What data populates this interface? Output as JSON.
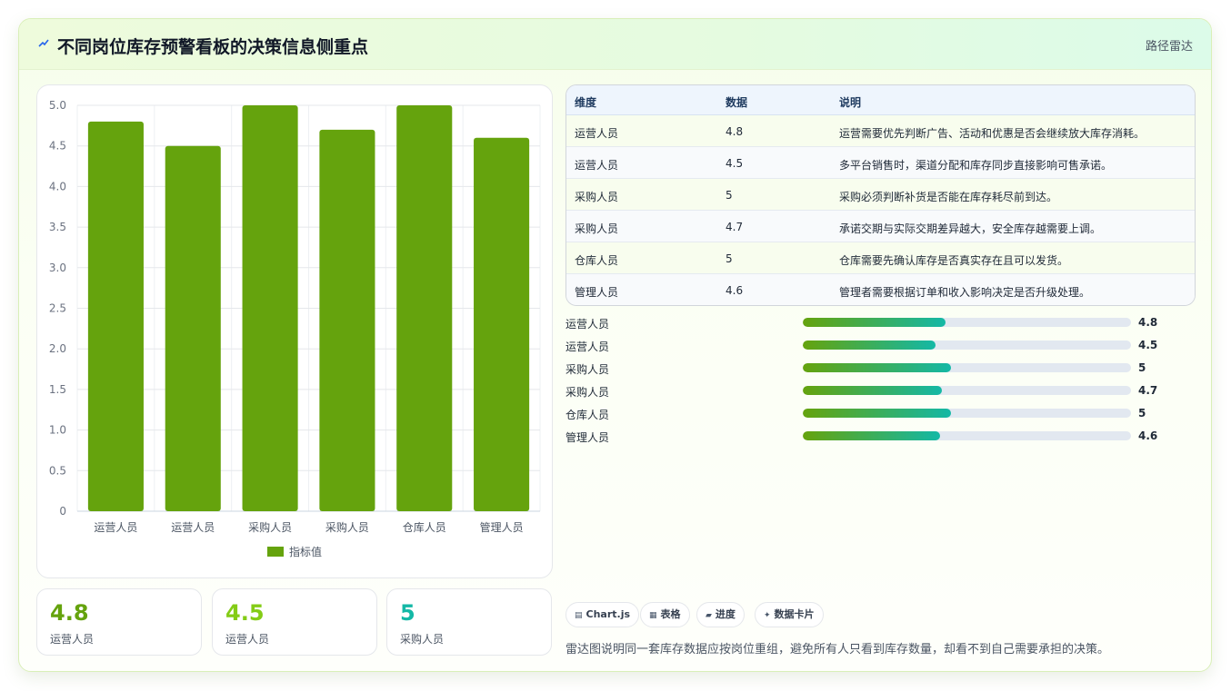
{
  "header": {
    "title": "不同岗位库存预警看板的决策信息侧重点",
    "nav_label": "路径雷达",
    "title_icon": "trend-icon"
  },
  "chart_data": {
    "type": "bar",
    "categories": [
      "运营人员",
      "运营人员",
      "采购人员",
      "采购人员",
      "仓库人员",
      "管理人员"
    ],
    "series": [
      {
        "name": "指标值",
        "values": [
          4.8,
          4.5,
          5,
          4.7,
          5,
          4.6
        ]
      }
    ],
    "yticks": [
      "0",
      "0.5",
      "1.0",
      "1.5",
      "2.0",
      "2.5",
      "3.0",
      "3.5",
      "4.0",
      "4.5",
      "5.0"
    ],
    "ylim": [
      0,
      5
    ],
    "grid": true,
    "legend_position": "bottom",
    "bar_color": "#65a30d"
  },
  "stats": [
    {
      "value": "4.8",
      "label": "运营人员",
      "color": "#65a30d"
    },
    {
      "value": "4.5",
      "label": "运营人员",
      "color": "#84cc16"
    },
    {
      "value": "5",
      "label": "采购人员",
      "color": "#14b8a6"
    }
  ],
  "table": {
    "headers": [
      "维度",
      "数据",
      "说明"
    ],
    "rows": [
      {
        "dim": "运营人员",
        "value": "4.8",
        "note": "运营需要优先判断广告、活动和优惠是否会继续放大库存消耗。"
      },
      {
        "dim": "运营人员",
        "value": "4.5",
        "note": "多平台销售时，渠道分配和库存同步直接影响可售承诺。"
      },
      {
        "dim": "采购人员",
        "value": "5",
        "note": "采购必须判断补货是否能在库存耗尽前到达。"
      },
      {
        "dim": "采购人员",
        "value": "4.7",
        "note": "承诺交期与实际交期差异越大，安全库存越需要上调。"
      },
      {
        "dim": "仓库人员",
        "value": "5",
        "note": "仓库需要先确认库存是否真实存在且可以发货。"
      },
      {
        "dim": "管理人员",
        "value": "4.6",
        "note": "管理者需要根据订单和收入影响决定是否升级处理。"
      }
    ]
  },
  "progress": {
    "max": 11.5,
    "items": [
      {
        "label": "运营人员",
        "value": "4.8",
        "fraction": 0.4348
      },
      {
        "label": "运营人员",
        "value": "4.5",
        "fraction": 0.4058
      },
      {
        "label": "采购人员",
        "value": "5",
        "fraction": 0.4522
      },
      {
        "label": "采购人员",
        "value": "4.7",
        "fraction": 0.4232
      },
      {
        "label": "仓库人员",
        "value": "5",
        "fraction": 0.4522
      },
      {
        "label": "管理人员",
        "value": "4.6",
        "fraction": 0.4174
      }
    ]
  },
  "chips": [
    {
      "icon": "chart-icon",
      "glyph": "▤",
      "label": "Chart.js"
    },
    {
      "icon": "table-icon",
      "glyph": "▦",
      "label": "表格"
    },
    {
      "icon": "progress-icon",
      "glyph": "▰",
      "label": "进度"
    },
    {
      "icon": "card-icon",
      "glyph": "✦",
      "label": "数据卡片"
    }
  ],
  "footer_note": "雷达图说明同一套库存数据应按岗位重组，避免所有人只看到库存数量，却看不到自己需要承担的决策。"
}
